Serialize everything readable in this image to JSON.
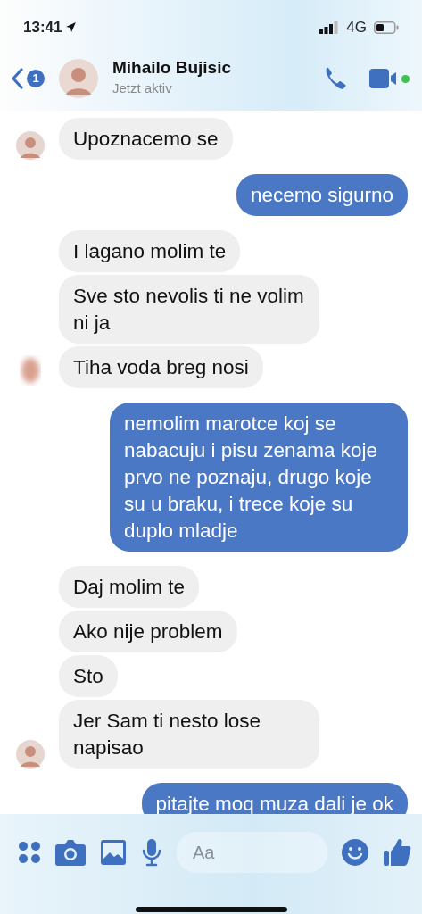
{
  "status_bar": {
    "time": "13:41",
    "network": "4G"
  },
  "header": {
    "unread_badge": "1",
    "contact_name": "Mihailo Bujisic",
    "presence": "Jetzt aktiv",
    "online": true
  },
  "messages": [
    {
      "kind": "received",
      "text": "Upoznacemo se",
      "avatar": {
        "kind": "photo"
      }
    },
    {
      "kind": "sent",
      "text": "necemo sigurno"
    },
    {
      "kind": "received",
      "text": "I lagano molim te"
    },
    {
      "kind": "received",
      "text": "Sve sto nevolis ti ne volim ni ja"
    },
    {
      "kind": "received",
      "text": "Tiha voda breg nosi",
      "avatar": {
        "kind": "blurred"
      }
    },
    {
      "kind": "sent",
      "text": "nemolim marotce koj se nabacuju i pisu zenama koje prvo ne poznaju, drugo koje su u braku, i trece koje su duplo mladje"
    },
    {
      "kind": "received",
      "text": "Daj molim te"
    },
    {
      "kind": "received",
      "text": "Ako nije problem"
    },
    {
      "kind": "received",
      "text": "Sto"
    },
    {
      "kind": "received",
      "text": "Jer Sam ti nesto lose napisao",
      "avatar": {
        "kind": "photo"
      }
    },
    {
      "kind": "sent",
      "text": "pitajte moq muza dali je ok"
    }
  ],
  "composer": {
    "placeholder": "Aa"
  }
}
